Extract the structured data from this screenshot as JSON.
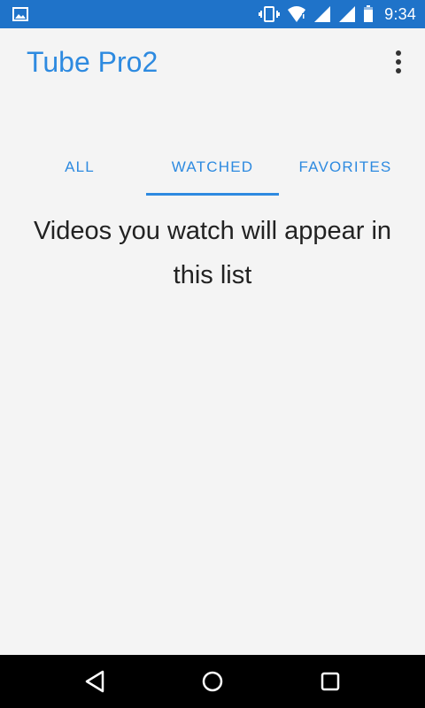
{
  "status_bar": {
    "time": "9:34",
    "icons": [
      "image-icon",
      "vibrate-icon",
      "wifi-icon",
      "signal-icon",
      "signal-icon",
      "battery-icon"
    ]
  },
  "app_bar": {
    "title": "Tube Pro2",
    "overflow_icon": "more-vert-icon"
  },
  "tabs": [
    {
      "label": "ALL",
      "selected": false
    },
    {
      "label": "WATCHED",
      "selected": true
    },
    {
      "label": "FAVORITES",
      "selected": false
    }
  ],
  "empty_message": "Videos you watch will appear in this list",
  "nav_bar": {
    "icons": [
      "back-icon",
      "home-icon",
      "recents-icon"
    ]
  },
  "colors": {
    "status_bar": "#1f73c9",
    "accent": "#2d8ae0",
    "background": "#f4f4f4",
    "text": "#222222",
    "nav_bar": "#000000"
  }
}
